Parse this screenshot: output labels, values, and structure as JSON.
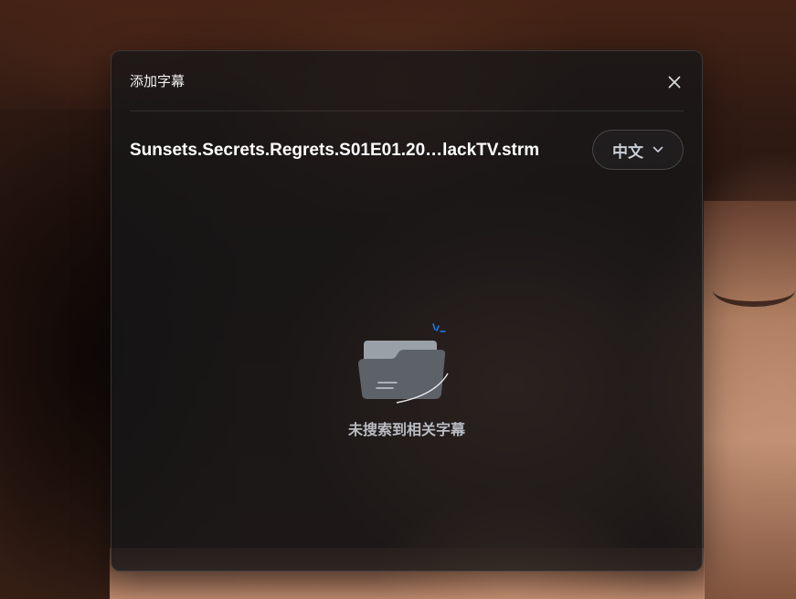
{
  "dialog": {
    "title": "添加字幕",
    "close_icon": "close-icon"
  },
  "file": {
    "name": "Sunsets.Secrets.Regrets.S01E01.20…lackTV.strm"
  },
  "language_select": {
    "value": "中文",
    "icon": "chevron-down-icon"
  },
  "empty_state": {
    "icon": "empty-folder-icon",
    "message": "未搜索到相关字幕"
  },
  "colors": {
    "accent": "#1e7cf2",
    "dialog_bg": "#161618",
    "text_primary": "#ffffff",
    "text_muted": "#b9bcc3"
  }
}
